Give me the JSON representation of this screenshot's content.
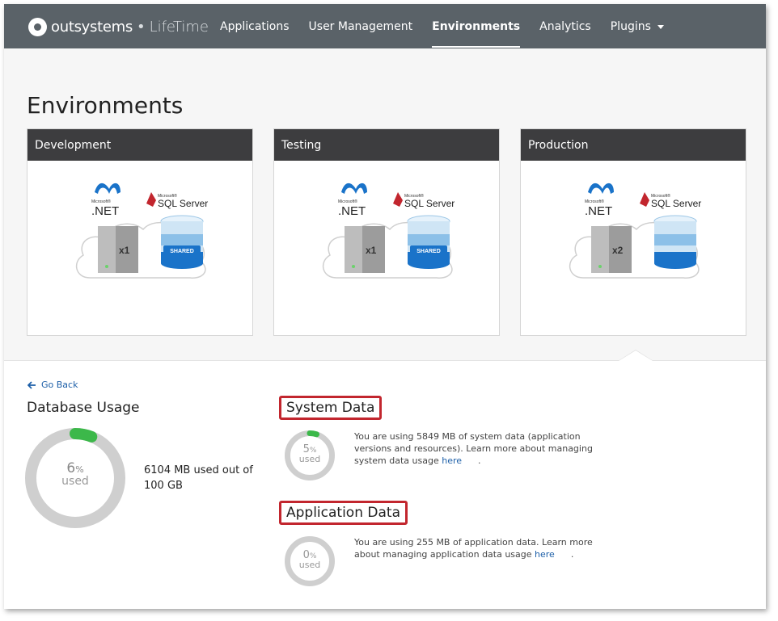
{
  "header": {
    "brand": "outsystems",
    "separator": "•",
    "product": "LifeTime",
    "nav": [
      {
        "label": "Applications"
      },
      {
        "label": "User Management"
      },
      {
        "label": "Environments"
      },
      {
        "label": "Analytics"
      },
      {
        "label": "Plugins"
      }
    ]
  },
  "page": {
    "title": "Environments"
  },
  "environments": [
    {
      "name": "Development",
      "servers": "x1",
      "db_badge": "SHARED",
      "net_vendor": "Microsoft®",
      "net_label": ".NET",
      "sql_vendor": "Microsoft®",
      "sql_label": "SQL Server"
    },
    {
      "name": "Testing",
      "servers": "x1",
      "db_badge": "SHARED",
      "net_vendor": "Microsoft®",
      "net_label": ".NET",
      "sql_vendor": "Microsoft®",
      "sql_label": "SQL Server"
    },
    {
      "name": "Production",
      "servers": "x2",
      "db_badge": "",
      "net_vendor": "Microsoft®",
      "net_label": ".NET",
      "sql_vendor": "Microsoft®",
      "sql_label": "SQL Server"
    }
  ],
  "details": {
    "go_back": "Go Back",
    "database_usage": {
      "title": "Database Usage",
      "percent": 6,
      "percent_text": "6",
      "percent_sign": "%",
      "used_label": "used",
      "summary": "6104 MB used out of 100 GB"
    },
    "system_data": {
      "title": "System Data",
      "percent": 5,
      "percent_text": "5",
      "percent_sign": "%",
      "used_label": "used",
      "description": "You are using 5849 MB of system data (application versions and resources). Learn more about managing system data usage ",
      "link_text": "here",
      "tail": "."
    },
    "application_data": {
      "title": "Application Data",
      "percent": 0,
      "percent_text": "0",
      "percent_sign": "%",
      "used_label": "used",
      "description": "You are using 255 MB of application data. Learn more about managing application data usage ",
      "link_text": "here",
      "tail": "."
    }
  },
  "colors": {
    "header_bg": "#5a6268",
    "card_header_bg": "#3d3d3f",
    "ring_track": "#cfcfcf",
    "ring_fill": "#3cb84a",
    "highlight_border": "#c2262e",
    "link": "#1d5fa8"
  }
}
